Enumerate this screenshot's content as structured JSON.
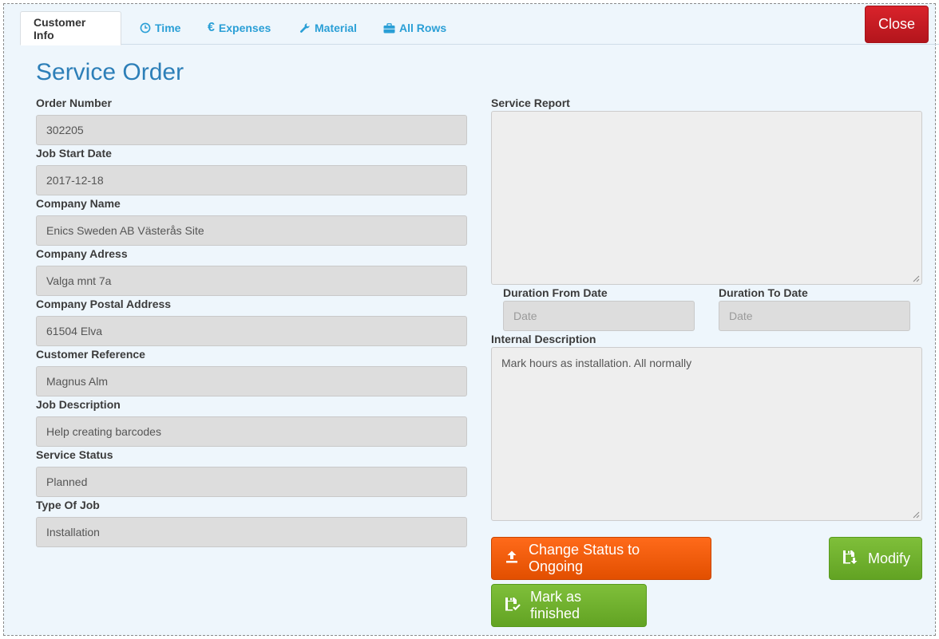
{
  "tabs": [
    {
      "label": "Customer Info",
      "icon": "none"
    },
    {
      "label": "Time",
      "icon": "clock-icon"
    },
    {
      "label": "Expenses",
      "icon": "euro-icon"
    },
    {
      "label": "Material",
      "icon": "wrench-icon"
    },
    {
      "label": "All Rows",
      "icon": "briefcase-icon"
    }
  ],
  "close_label": "Close",
  "title": "Service Order",
  "fields": {
    "order_number": {
      "label": "Order Number",
      "value": "302205"
    },
    "job_start_date": {
      "label": "Job Start Date",
      "value": "2017-12-18"
    },
    "company_name": {
      "label": "Company Name",
      "value": "Enics Sweden AB Västerås Site"
    },
    "company_address": {
      "label": "Company Adress",
      "value": "Valga mnt 7a"
    },
    "company_postal": {
      "label": "Company Postal Address",
      "value": "61504 Elva"
    },
    "customer_reference": {
      "label": "Customer Reference",
      "value": "Magnus Alm"
    },
    "job_description": {
      "label": "Job Description",
      "value": "Help creating barcodes"
    },
    "service_status": {
      "label": "Service Status",
      "value": "Planned"
    },
    "type_of_job": {
      "label": "Type Of Job",
      "value": "Installation"
    }
  },
  "service_report": {
    "label": "Service Report",
    "value": ""
  },
  "duration_from": {
    "label": "Duration From Date",
    "placeholder": "Date"
  },
  "duration_to": {
    "label": "Duration To Date",
    "placeholder": "Date"
  },
  "internal_description": {
    "label": "Internal Description",
    "value": "Mark hours as installation. All normally"
  },
  "buttons": {
    "change_status": "Change Status to Ongoing",
    "modify": "Modify",
    "mark_finished": "Mark as finished"
  },
  "colors": {
    "accent": "#2a9fd6",
    "close": "#c91b22",
    "orange": "#f25c05",
    "green": "#6db02e"
  }
}
